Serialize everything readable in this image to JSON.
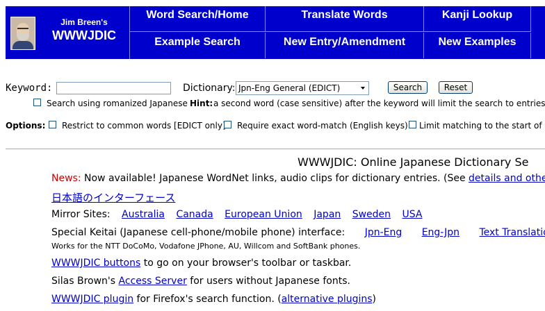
{
  "header": {
    "brand_top": "Jim Breen's",
    "brand_main": "WWWJDIC",
    "nav": [
      {
        "label": "Word Search/Home"
      },
      {
        "label": "Translate Words"
      },
      {
        "label": "Kanji Lookup"
      },
      {
        "label": "Example Search"
      },
      {
        "label": "New Entry/Amendment"
      },
      {
        "label": "New Examples"
      }
    ]
  },
  "form": {
    "keyword_label": "Keyword:",
    "keyword_value": "",
    "dictionary_label": "Dictionary:",
    "dictionary_selected": "Jpn-Eng General (EDICT)",
    "search_button": "Search",
    "reset_button": "Reset",
    "romanized_label": "Search using romanized Japanese",
    "hint_label": "Hint:",
    "hint_text": "a second word (case sensitive) after the keyword will limit the search to entries cont",
    "options_label": "Options:",
    "opt_common": "Restrict to common words [EDICT only]",
    "opt_exact": "Require exact word-match (English keys)",
    "opt_limit": "Limit matching to the start of w"
  },
  "content": {
    "title": "WWWJDIC: Online Japanese Dictionary Se",
    "news_label": "News:",
    "news_text": "Now available! Japanese WordNet links, audio clips for dictionary entries. (See ",
    "news_link": "details and other dev",
    "japanese_interface": "日本語のインターフェース",
    "mirror_label": "Mirror Sites:",
    "mirrors": [
      "Australia",
      "Canada",
      "European Union",
      "Japan",
      "Sweden",
      "USA"
    ],
    "keitai_text": "Special Keitai (Japanese cell-phone/mobile phone) interface:",
    "keitai_links": [
      "Jpn-Eng",
      "Eng-Jpn",
      "Text Translation"
    ],
    "keitai_note": "Works for the NTT DoCoMo, Vodafone JPhone, AU, Willcom and SoftBank phones.",
    "buttons_link": "WWWJDIC buttons",
    "buttons_text": " to go on your browser's toolbar or taskbar.",
    "silas_text": "Silas Brown's ",
    "silas_link": "Access Server",
    "silas_text2": " for users without Japanese fonts.",
    "plugin_link": "WWWJDIC plugin",
    "plugin_text": " for Firefox's search function. (",
    "plugin_alt": "alternative plugins",
    "plugin_close": ")"
  }
}
